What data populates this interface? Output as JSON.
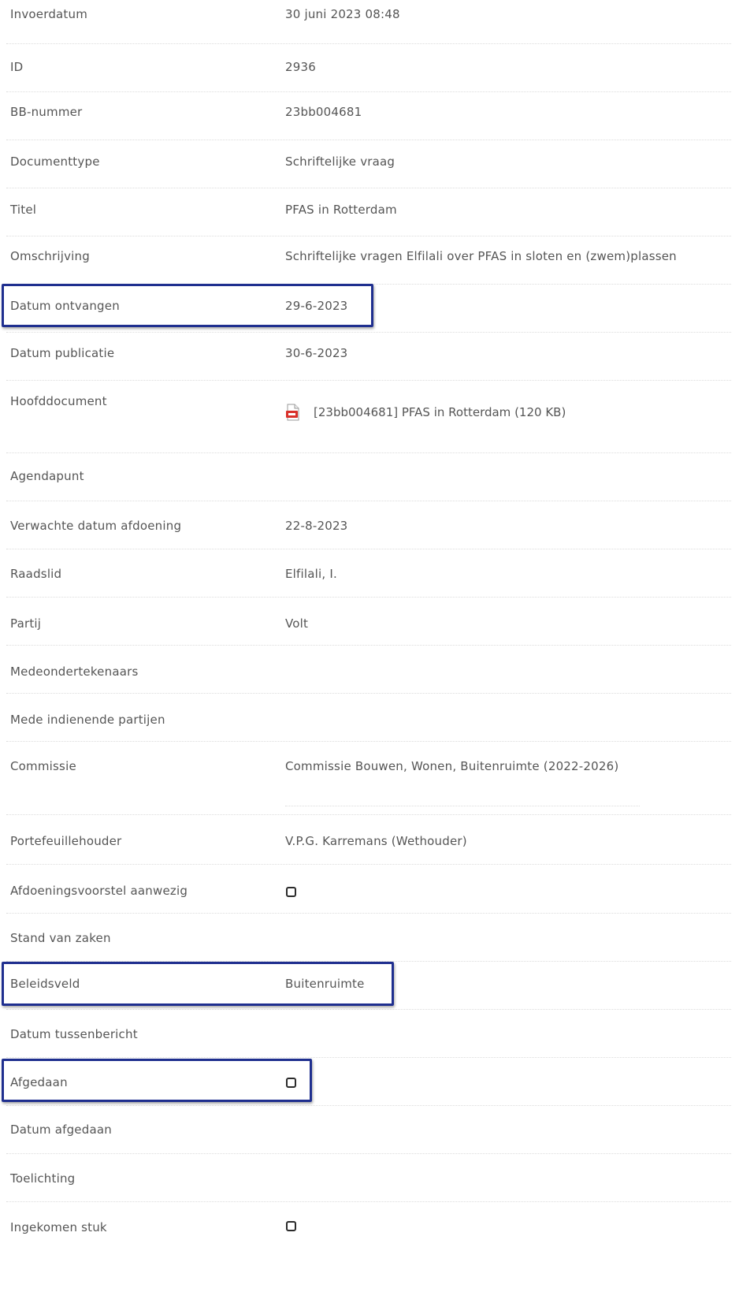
{
  "rows": {
    "invoerdatum": {
      "label": "Invoerdatum",
      "value": "30 juni 2023 08:48"
    },
    "id": {
      "label": "ID",
      "value": "2936"
    },
    "bb_nummer": {
      "label": "BB-nummer",
      "value": "23bb004681"
    },
    "documenttype": {
      "label": "Documenttype",
      "value": "Schriftelijke vraag"
    },
    "titel": {
      "label": "Titel",
      "value": "PFAS in Rotterdam"
    },
    "omschrijving": {
      "label": "Omschrijving",
      "value": "Schriftelijke vragen Elfilali over PFAS in sloten en (zwem)plassen"
    },
    "datum_ontvangen": {
      "label": "Datum ontvangen",
      "value": "29-6-2023"
    },
    "datum_publicatie": {
      "label": "Datum publicatie",
      "value": "30-6-2023"
    },
    "hoofddocument": {
      "label": "Hoofddocument",
      "value": "[23bb004681] PFAS in Rotterdam (120 KB)",
      "icon": "pdf-file-icon"
    },
    "agendapunt": {
      "label": "Agendapunt"
    },
    "verwachte_datum_afdoening": {
      "label": "Verwachte datum afdoening",
      "value": "22-8-2023"
    },
    "raadslid": {
      "label": "Raadslid",
      "value": "Elfilali, I."
    },
    "partij": {
      "label": "Partij",
      "value": "Volt"
    },
    "medeondertekenaars": {
      "label": "Medeondertekenaars"
    },
    "mede_indienende_partijen": {
      "label": "Mede indienende partijen"
    },
    "commissie": {
      "label": "Commissie",
      "value": "Commissie Bouwen, Wonen, Buitenruimte (2022-2026)"
    },
    "portefeuillehouder": {
      "label": "Portefeuillehouder",
      "value": "V.P.G. Karremans (Wethouder)"
    },
    "afdoeningsvoorstel_aanwezig": {
      "label": "Afdoeningsvoorstel aanwezig",
      "checked": false
    },
    "stand_van_zaken": {
      "label": "Stand van zaken"
    },
    "beleidsveld": {
      "label": "Beleidsveld",
      "value": "Buitenruimte"
    },
    "datum_tussenbericht": {
      "label": "Datum tussenbericht"
    },
    "afgedaan": {
      "label": "Afgedaan",
      "checked": false
    },
    "datum_afgedaan": {
      "label": "Datum afgedaan"
    },
    "toelichting": {
      "label": "Toelichting"
    },
    "ingekomen_stuk": {
      "label": "Ingekomen stuk",
      "checked": false
    }
  },
  "colors": {
    "text": "#555555",
    "highlight_border": "#1f2f8f",
    "divider": "#dcdcdc",
    "pdf_icon": "#d9312b"
  }
}
